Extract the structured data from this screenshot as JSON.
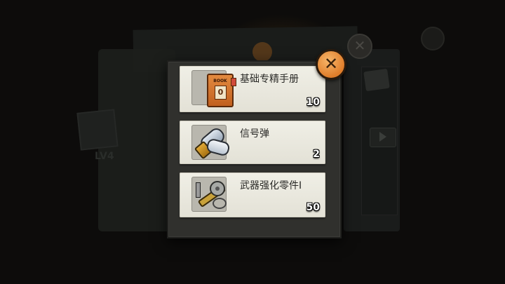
{
  "popup": {
    "close_icon_glyph": "✕",
    "items": [
      {
        "name": "基础专精手册",
        "count": "10",
        "icon": "manual-book-icon",
        "book_label": "BOOK",
        "book_number": "0"
      },
      {
        "name": "信号弹",
        "count": "2",
        "icon": "flare-icon"
      },
      {
        "name": "武器强化零件I",
        "count": "50",
        "icon": "weapon-parts-icon"
      }
    ]
  },
  "background": {
    "left_card_label": "LV4"
  },
  "colors": {
    "panel": "#30302d",
    "item_card": "#eceae0",
    "close_button": "#e9913c",
    "count_text": "#ffffff"
  }
}
